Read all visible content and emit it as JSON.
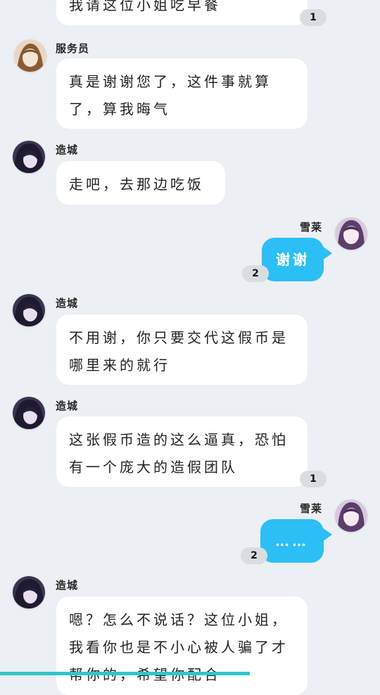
{
  "messages": [
    {
      "text": "我请这位小姐吃早餐",
      "badge": "1"
    },
    {
      "sender": "服务员",
      "text": "真是谢谢您了，这件事就算了，算我晦气"
    },
    {
      "sender": "造城",
      "text": "走吧，去那边吃饭"
    },
    {
      "sender": "雪莱",
      "text": "谢谢",
      "badge": "2"
    },
    {
      "sender": "造城",
      "text": "不用谢，你只要交代这假币是哪里来的就行"
    },
    {
      "sender": "造城",
      "text": "这张假币造的这么逼真，恐怕有一个庞大的造假团队",
      "badge": "1"
    },
    {
      "sender": "雪莱",
      "text": "……",
      "badge": "2"
    },
    {
      "sender": "造城",
      "text": "嗯？怎么不说话？这位小姐，我看你也是不小心被人骗了才帮你的，希望你配合"
    }
  ],
  "colors": {
    "background": "#eceff3",
    "bubble_left": "#ffffff",
    "bubble_right": "#2bbff5",
    "badge": "#d9dde2"
  }
}
